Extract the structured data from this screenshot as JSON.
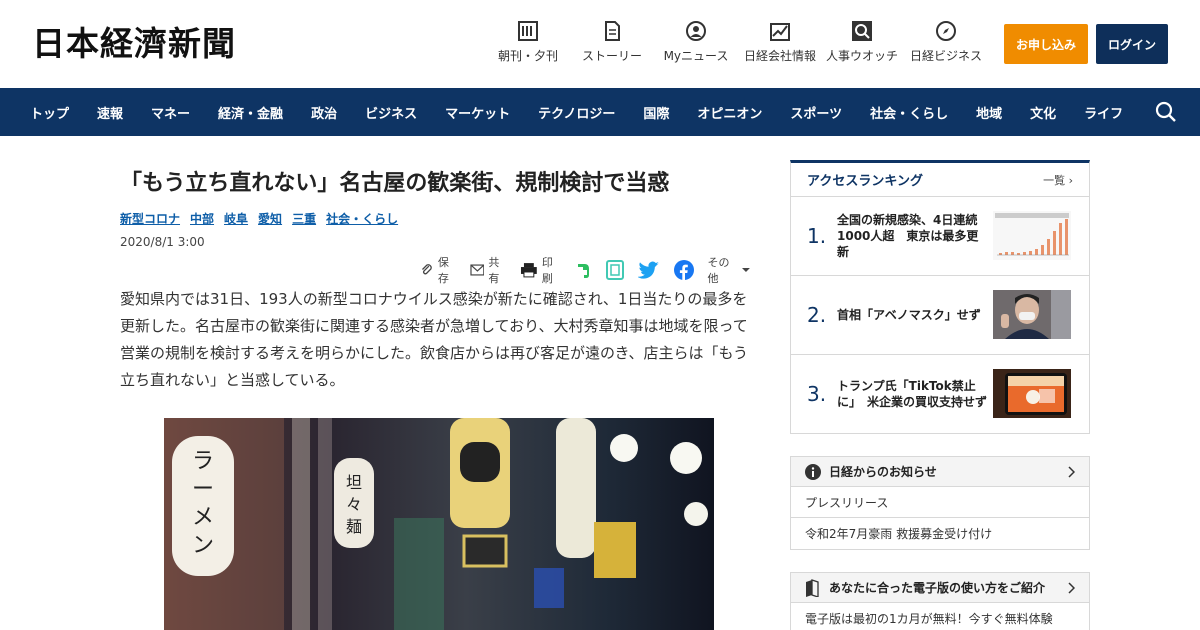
{
  "header": {
    "logo": "日本経濟新聞",
    "nav": [
      {
        "label": "朝刊・夕刊",
        "icon": "newspaper-icon"
      },
      {
        "label": "ストーリー",
        "icon": "story-icon"
      },
      {
        "label": "Myニュース",
        "icon": "user-icon"
      },
      {
        "label": "日経会社情報",
        "icon": "chart-icon"
      },
      {
        "label": "人事ウオッチ",
        "icon": "search-person-icon"
      },
      {
        "label": "日経ビジネス",
        "icon": "compass-icon"
      }
    ],
    "apply_label": "お申し込み",
    "login_label": "ログイン",
    "apply_color": "#f08c00",
    "login_color": "#0e2f5a"
  },
  "navbar": {
    "items": [
      "トップ",
      "速報",
      "マネー",
      "経済・金融",
      "政治",
      "ビジネス",
      "マーケット",
      "テクノロジー",
      "国際",
      "オピニオン",
      "スポーツ",
      "社会・くらし",
      "地域",
      "文化",
      "ライフ"
    ],
    "color": "#0e3464"
  },
  "article": {
    "title": "「もう立ち直れない」名古屋の歓楽街、規制検討で当惑",
    "tags": [
      "新型コロナ",
      "中部",
      "岐阜",
      "愛知",
      "三重",
      "社会・くらし"
    ],
    "date": "2020/8/1 3:00",
    "share": {
      "save": "保存",
      "share": "共有",
      "print": "印刷",
      "other": "その他"
    },
    "body": "愛知県内では31日、193人の新型コロナウイルス感染が新たに確認され、1日当たりの最多を更新した。名古屋市の歓楽街に関連する感染者が急増しており、大村秀章知事は地域を限って営業の規制を検討する考えを明らかにした。飲食店からは再び客足が遠のき、店主らは「もう立ち直れない」と当惑している。",
    "photo_signs": [
      "ラーメン",
      "坦々麺"
    ]
  },
  "sidebar": {
    "ranking": {
      "title": "アクセスランキング",
      "more": "一覧",
      "items": [
        {
          "num": "1.",
          "text": "全国の新規感染、4日連続1000人超　東京は最多更新"
        },
        {
          "num": "2.",
          "text": "首相「アベノマスク」せず"
        },
        {
          "num": "3.",
          "text": "トランプ氏「TikTok禁止に」　米企業の買収支持せず"
        }
      ]
    },
    "notice": {
      "title": "日経からのお知らせ",
      "rows": [
        "プレスリリース",
        "令和2年7月豪雨 救援募金受け付け"
      ]
    },
    "guide": {
      "title": "あなたに合った電子版の使い方をご紹介",
      "row": "電子版は最初の1カ月が無料！今すぐ無料体験"
    }
  }
}
